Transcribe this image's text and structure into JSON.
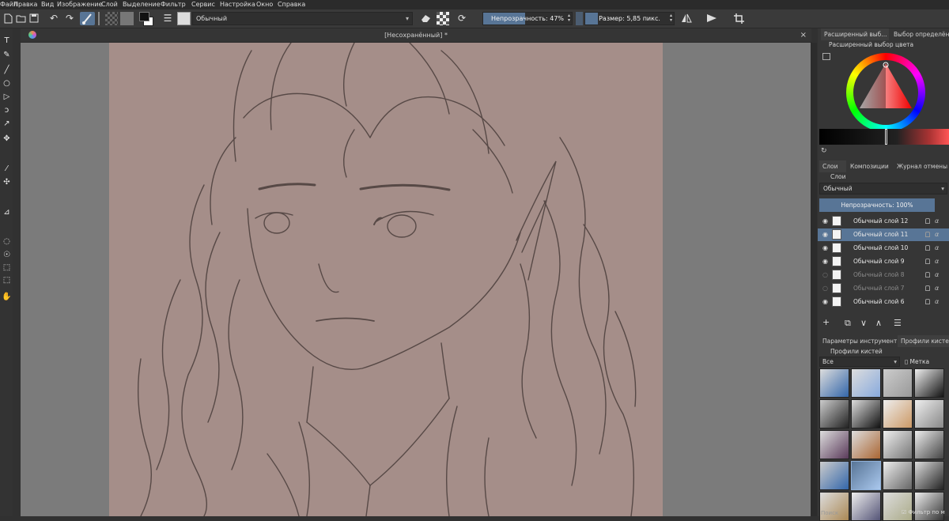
{
  "menu": [
    "Файл",
    "Правка",
    "Вид",
    "Изображение",
    "Слой",
    "Выделение",
    "Фильтр",
    "Сервис",
    "Настройка",
    "Окно",
    "Справка"
  ],
  "toolbar": {
    "blend_mode": "Обычный",
    "opacity_label": "Непрозрачность: 47%",
    "opacity_value": 47,
    "size_label": "Размер: 5,85 пикс."
  },
  "document": {
    "title": "[Несохранённый]",
    "modified_mark": "*"
  },
  "panels": {
    "color_tabs": [
      "Расширенный выб...",
      "Выбор определённ..."
    ],
    "color_docker_title": "Расширенный выбор цвета",
    "layer_tabs": [
      "Слои",
      "Композиции",
      "Журнал отмены"
    ],
    "layers_docker_title": "Слои",
    "layer_blend_mode": "Обычный",
    "layer_opacity_label": "Непрозрачность: 100%",
    "layers": [
      {
        "name": "Обычный слой 12",
        "visible": true,
        "selected": false
      },
      {
        "name": "Обычный слой 11",
        "visible": true,
        "selected": true
      },
      {
        "name": "Обычный слой 10",
        "visible": true,
        "selected": false
      },
      {
        "name": "Обычный слой 9",
        "visible": true,
        "selected": false
      },
      {
        "name": "Обычный слой 8",
        "visible": false,
        "selected": false
      },
      {
        "name": "Обычный слой 7",
        "visible": false,
        "selected": false
      },
      {
        "name": "Обычный слой 6",
        "visible": true,
        "selected": false
      }
    ],
    "alpha_symbol": "α",
    "tool_tabs": [
      "Параметры инструмента",
      "Профили кистей"
    ],
    "brush_docker_title": "Профили кистей",
    "brush_filter": "Все",
    "brush_tag_label": "Метка",
    "search_label": "Поиск",
    "filter_label": "Фильтр по м"
  },
  "colors": {
    "accent": "#587596",
    "canvas": "#a58e89",
    "viewport": "#7b7b7b",
    "selected_layer": "#587596"
  }
}
